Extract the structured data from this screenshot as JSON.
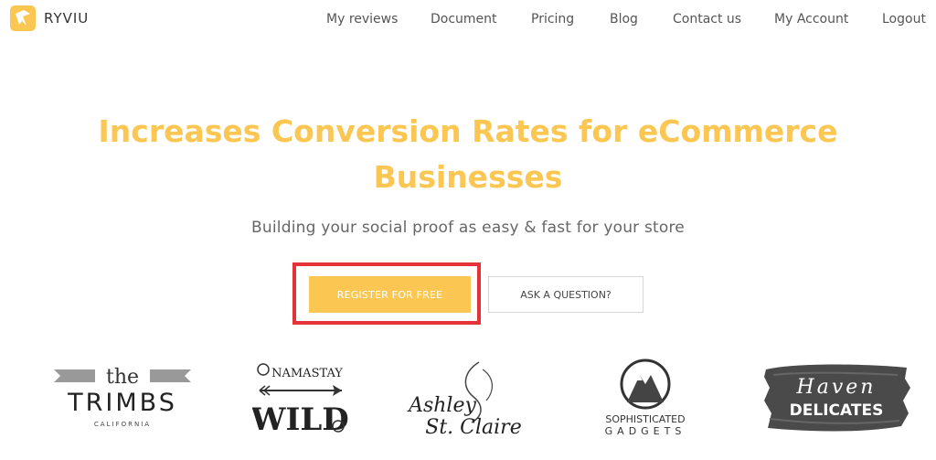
{
  "brand": {
    "name": "RYVIU",
    "logo_icon": "ryviu-logo-icon"
  },
  "nav": {
    "items": [
      {
        "label": "My reviews"
      },
      {
        "label": "Document"
      },
      {
        "label": "Pricing"
      },
      {
        "label": "Blog"
      },
      {
        "label": "Contact us"
      },
      {
        "label": "My Account"
      },
      {
        "label": "Logout"
      }
    ]
  },
  "hero": {
    "title_line1": "Increases Conversion Rates for eCommerce",
    "title_line2": "Businesses",
    "subtitle": "Building your social proof as easy & fast for your store",
    "register_label": "REGISTER FOR FREE",
    "ask_label": "ASK A QUESTION?"
  },
  "customers": {
    "trimbs": {
      "small": "the",
      "main": "TRIMBS",
      "sub": "CALIFORNIA"
    },
    "namastay": {
      "top": "NAMASTAY",
      "bottom": "WILD"
    },
    "ashley": {
      "line1": "Ashley",
      "line2": "St. Claire"
    },
    "gadgets": {
      "line1": "SOPHISTICATED",
      "line2": "GADGETS"
    },
    "haven": {
      "line1": "Haven",
      "line2": "DELICATES"
    }
  },
  "colors": {
    "accent": "#fbc652",
    "highlight": "#e53238"
  }
}
